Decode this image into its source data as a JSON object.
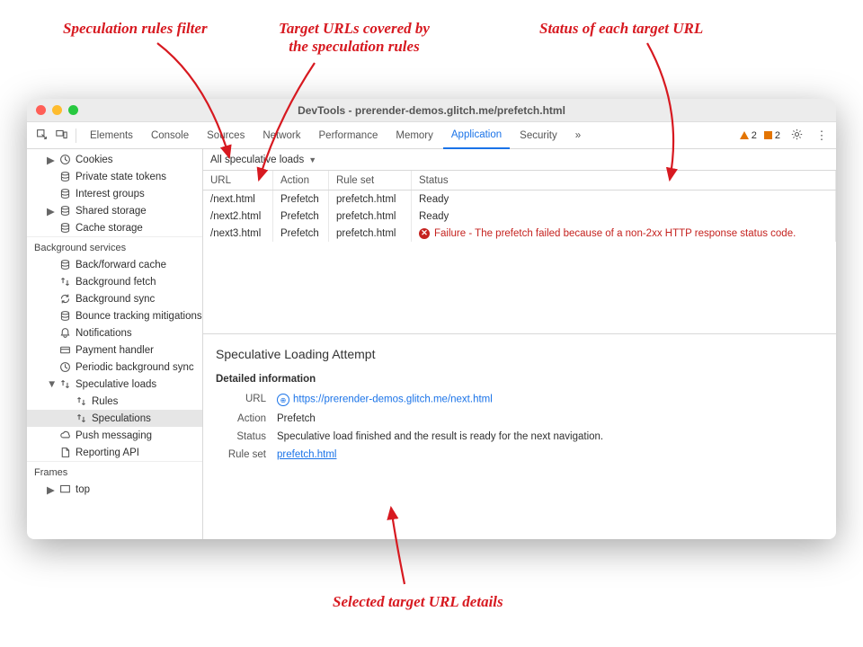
{
  "annotations": {
    "filter": "Speculation rules filter",
    "urls": "Target URLs covered by\nthe speculation rules",
    "status": "Status of each target URL",
    "detail": "Selected target URL details"
  },
  "window": {
    "title": "DevTools - prerender-demos.glitch.me/prefetch.html"
  },
  "tabs": {
    "items": [
      "Elements",
      "Console",
      "Sources",
      "Network",
      "Performance",
      "Memory",
      "Application",
      "Security"
    ],
    "overflow": "»",
    "warnings": "2",
    "messages": "2"
  },
  "sidebar": {
    "storage": [
      {
        "label": "Cookies",
        "icon": "clock",
        "arrow": true
      },
      {
        "label": "Private state tokens",
        "icon": "db"
      },
      {
        "label": "Interest groups",
        "icon": "db"
      },
      {
        "label": "Shared storage",
        "icon": "db",
        "arrow": true
      },
      {
        "label": "Cache storage",
        "icon": "db"
      }
    ],
    "bg_header": "Background services",
    "bg": [
      {
        "label": "Back/forward cache",
        "icon": "db"
      },
      {
        "label": "Background fetch",
        "icon": "updown"
      },
      {
        "label": "Background sync",
        "icon": "sync"
      },
      {
        "label": "Bounce tracking mitigations",
        "icon": "db"
      },
      {
        "label": "Notifications",
        "icon": "bell"
      },
      {
        "label": "Payment handler",
        "icon": "card"
      },
      {
        "label": "Periodic background sync",
        "icon": "clock"
      },
      {
        "label": "Speculative loads",
        "icon": "updown",
        "arrow": true,
        "open": true,
        "children": [
          {
            "label": "Rules",
            "icon": "updown"
          },
          {
            "label": "Speculations",
            "icon": "updown",
            "selected": true
          }
        ]
      },
      {
        "label": "Push messaging",
        "icon": "cloud"
      },
      {
        "label": "Reporting API",
        "icon": "doc"
      }
    ],
    "frames_header": "Frames",
    "frames": [
      {
        "label": "top",
        "icon": "frame",
        "arrow": true
      }
    ]
  },
  "filter": {
    "label": "All speculative loads"
  },
  "grid": {
    "headers": {
      "url": "URL",
      "action": "Action",
      "ruleset": "Rule set",
      "status": "Status"
    },
    "rows": [
      {
        "url": "/next.html",
        "action": "Prefetch",
        "ruleset": "prefetch.html",
        "status": "Ready",
        "err": false
      },
      {
        "url": "/next2.html",
        "action": "Prefetch",
        "ruleset": "prefetch.html",
        "status": "Ready",
        "err": false
      },
      {
        "url": "/next3.html",
        "action": "Prefetch",
        "ruleset": "prefetch.html",
        "status": "Failure - The prefetch failed because of a non-2xx HTTP response status code.",
        "err": true
      }
    ]
  },
  "detail": {
    "title": "Speculative Loading Attempt",
    "section": "Detailed information",
    "url_label": "URL",
    "url": "https://prerender-demos.glitch.me/next.html",
    "action_label": "Action",
    "action": "Prefetch",
    "status_label": "Status",
    "status": "Speculative load finished and the result is ready for the next navigation.",
    "ruleset_label": "Rule set",
    "ruleset": "prefetch.html"
  }
}
